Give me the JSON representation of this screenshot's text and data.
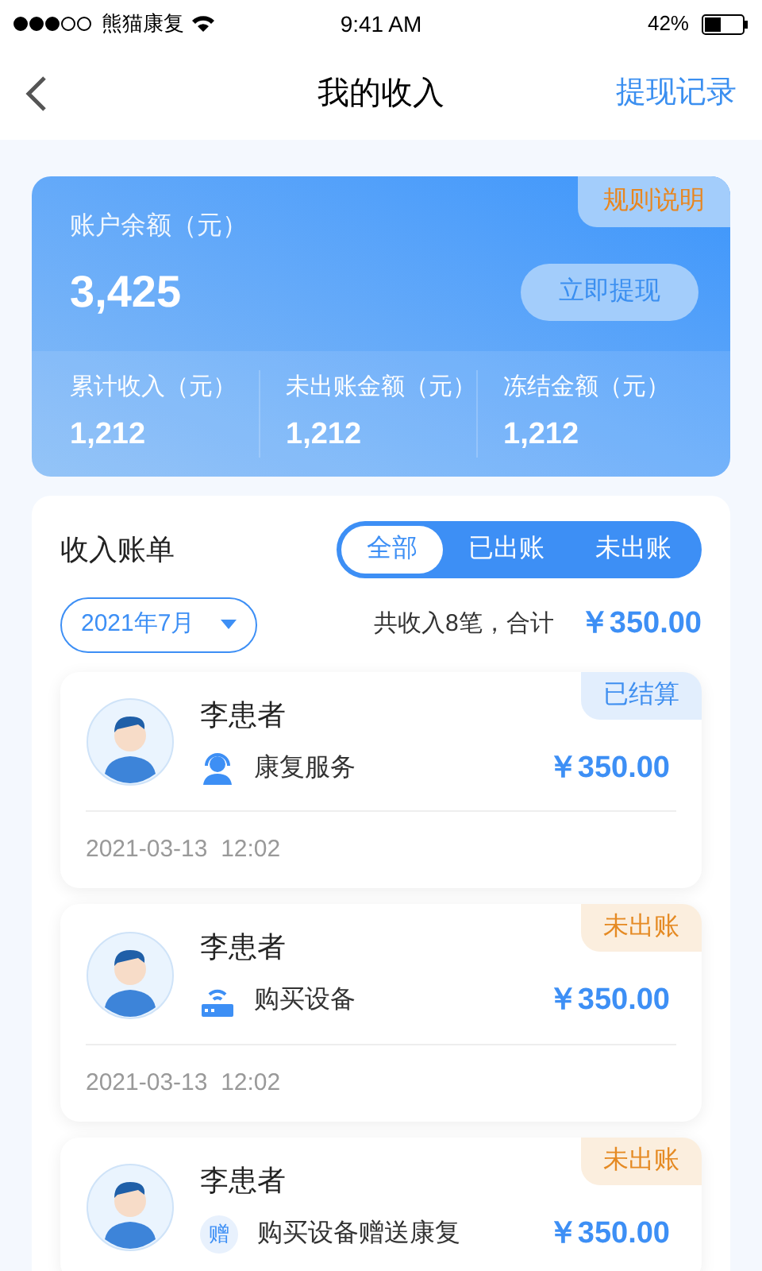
{
  "status_bar": {
    "carrier": "熊猫康复",
    "time": "9:41 AM",
    "battery": "42%"
  },
  "nav": {
    "title": "我的收入",
    "action": "提现记录"
  },
  "balance_card": {
    "rules": "规则说明",
    "label": "账户余额（元）",
    "amount": "3,425",
    "withdraw": "立即提现",
    "stats": [
      {
        "label": "累计收入（元）",
        "value": "1,212"
      },
      {
        "label": "未出账金额（元）",
        "value": "1,212"
      },
      {
        "label": "冻结金额（元）",
        "value": "1,212"
      }
    ]
  },
  "bills": {
    "title": "收入账单",
    "tabs": [
      {
        "label": "全部",
        "selected": true
      },
      {
        "label": "已出账",
        "selected": false
      },
      {
        "label": "未出账",
        "selected": false
      }
    ],
    "month": "2021年7月",
    "summary": "共收入8笔，合计",
    "total": "￥350.00",
    "items": [
      {
        "name": "李患者",
        "kind": "service",
        "type": "康复服务",
        "amount": "￥350.00",
        "color": "#3f8ff0",
        "status_label": "已结算",
        "time": "2021-03-13  12:02"
      },
      {
        "name": "李患者",
        "kind": "device",
        "type": "购买设备",
        "amount": "￥350.00",
        "color": "#e58a23",
        "status_label": "未出账",
        "time": "2021-03-13  12:02"
      },
      {
        "name": "李患者",
        "kind": "gift",
        "badge": "赠",
        "type": "购买设备赠送康复",
        "amount": "￥350.00",
        "color": "#e58a23",
        "status_label": "未出账"
      }
    ]
  }
}
